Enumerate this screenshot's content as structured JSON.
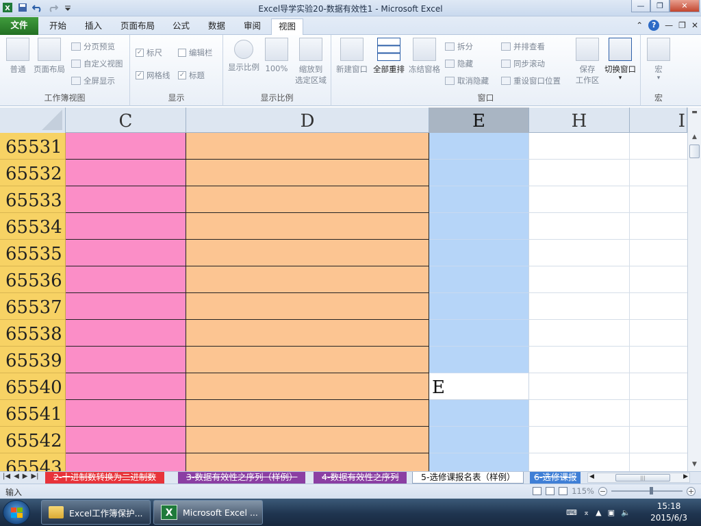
{
  "window": {
    "title": "Excel导学实验20-数据有效性1  -  Microsoft Excel"
  },
  "ribbon_tabs": {
    "file": "文件",
    "items": [
      "开始",
      "插入",
      "页面布局",
      "公式",
      "数据",
      "审阅",
      "视图"
    ],
    "active": "视图"
  },
  "ribbon": {
    "workbook_views": {
      "label": "工作簿视图",
      "normal": "普通",
      "page_layout": "页面布局",
      "page_break": "分页预览",
      "custom_views": "自定义视图",
      "full_screen": "全屏显示"
    },
    "show": {
      "label": "显示",
      "ruler": "标尺",
      "formula_bar": "编辑栏",
      "gridlines": "网格线",
      "headings": "标题"
    },
    "zoom": {
      "label": "显示比例",
      "zoom": "显示比例",
      "hundred": "100%",
      "zoom_selection_1": "缩放到",
      "zoom_selection_2": "选定区域"
    },
    "window": {
      "label": "窗口",
      "new_window": "新建窗口",
      "arrange_all": "全部重排",
      "freeze_panes": "冻结窗格",
      "split": "拆分",
      "hide": "隐藏",
      "unhide": "取消隐藏",
      "side_by_side": "并排查看",
      "sync_scroll": "同步滚动",
      "reset_position": "重设窗口位置",
      "save_workspace_1": "保存",
      "save_workspace_2": "工作区",
      "switch_windows": "切换窗口"
    },
    "macros": {
      "label": "宏",
      "macros": "宏"
    }
  },
  "grid": {
    "columns": [
      "C",
      "D",
      "E",
      "H",
      "I"
    ],
    "selected_column": "E",
    "rows": [
      {
        "num": "65531",
        "e": ""
      },
      {
        "num": "65532",
        "e": ""
      },
      {
        "num": "65533",
        "e": ""
      },
      {
        "num": "65534",
        "e": ""
      },
      {
        "num": "65535",
        "e": ""
      },
      {
        "num": "65536",
        "e": ""
      },
      {
        "num": "65537",
        "e": ""
      },
      {
        "num": "65538",
        "e": ""
      },
      {
        "num": "65539",
        "e": ""
      },
      {
        "num": "65540",
        "e": "E"
      },
      {
        "num": "65541",
        "e": ""
      },
      {
        "num": "65542",
        "e": ""
      },
      {
        "num": "65543",
        "e": ""
      }
    ],
    "colors": {
      "c": "#fb8ec7",
      "d": "#fcc592",
      "e": "#b6d5f8",
      "row_header": "#f7d264"
    }
  },
  "sheets": [
    {
      "label": "2-十进制数转换为二进制数",
      "color": "#e8333a",
      "text": "#ffffff"
    },
    {
      "label": "3-数据有效性之序列（样例）",
      "color": "#8b3fa3",
      "text": "#ffffff"
    },
    {
      "label": "4-数据有效性之序列",
      "color": "#8b3fa3",
      "text": "#ffffff"
    },
    {
      "label": "5-选修课报名表（样例）",
      "color": "#ffffff",
      "text": "#111111"
    },
    {
      "label": "6-选修课报",
      "color": "#3f7fd6",
      "text": "#ffffff"
    }
  ],
  "status": {
    "mode": "输入",
    "zoom": "115%"
  },
  "taskbar": {
    "items": [
      "Excel工作簿保护...",
      "Microsoft Excel ..."
    ],
    "time": "15:18",
    "date": "2015/6/3"
  }
}
